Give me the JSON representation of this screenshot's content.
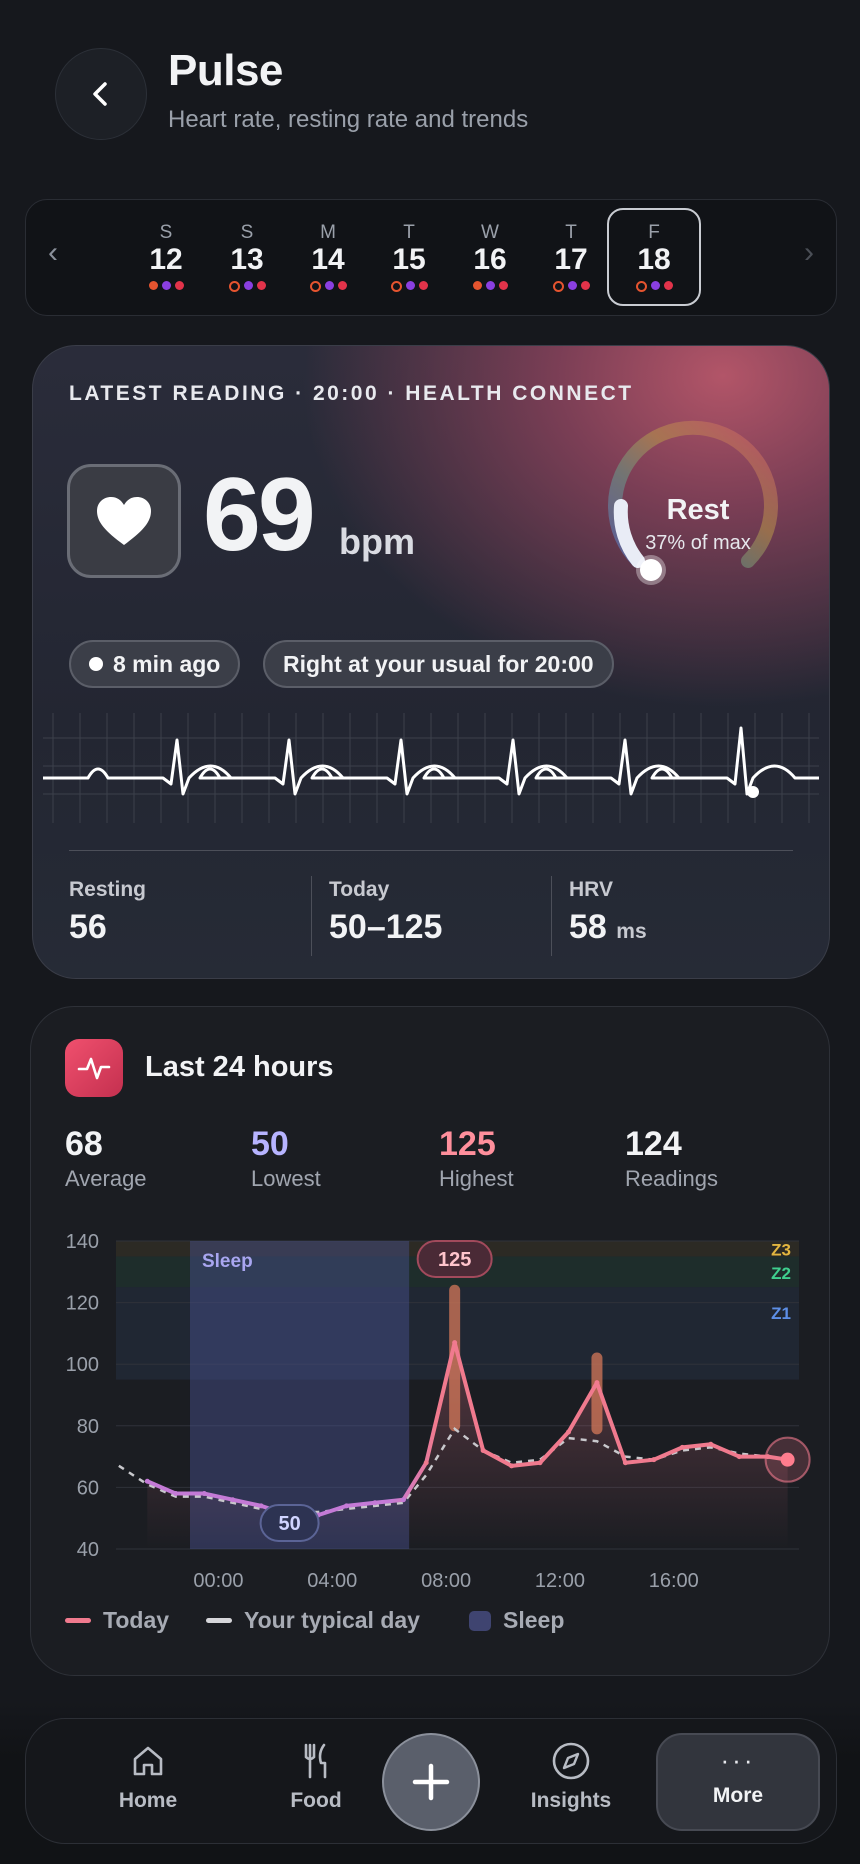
{
  "header": {
    "title": "Pulse",
    "subtitle": "Heart rate, resting rate and trends"
  },
  "days": [
    {
      "letter": "S",
      "num": "12",
      "dots": [
        "#e5542f",
        "#8a3fe0",
        "#e2334a"
      ],
      "filled": [
        true,
        true,
        true
      ]
    },
    {
      "letter": "S",
      "num": "13",
      "dots": [
        "#e5542f",
        "#8a3fe0",
        "#e2334a"
      ],
      "filled": [
        false,
        true,
        true
      ]
    },
    {
      "letter": "M",
      "num": "14",
      "dots": [
        "#e5542f",
        "#8a3fe0",
        "#e2334a"
      ],
      "filled": [
        false,
        true,
        true
      ]
    },
    {
      "letter": "T",
      "num": "15",
      "dots": [
        "#e5542f",
        "#8a3fe0",
        "#e2334a"
      ],
      "filled": [
        false,
        true,
        true
      ]
    },
    {
      "letter": "W",
      "num": "16",
      "dots": [
        "#e5542f",
        "#8a3fe0",
        "#e2334a"
      ],
      "filled": [
        true,
        true,
        true
      ]
    },
    {
      "letter": "T",
      "num": "17",
      "dots": [
        "#e5542f",
        "#8a3fe0",
        "#e2334a"
      ],
      "filled": [
        false,
        true,
        true
      ]
    },
    {
      "letter": "F",
      "num": "18",
      "dots": [
        "#e5542f",
        "#8a3fe0",
        "#e2334a"
      ],
      "filled": [
        false,
        true,
        true
      ],
      "selected": true
    }
  ],
  "latest": {
    "eyebrow": "LATEST READING · 20:00 · HEALTH CONNECT",
    "bpm": "69",
    "unit": "bpm",
    "zone": "Rest",
    "zone_pct": "37% of max",
    "pill_time": "8 min ago",
    "pill_context": "Right at your usual for 20:00",
    "stats": [
      {
        "label": "Resting",
        "value": "56",
        "unit": ""
      },
      {
        "label": "Today",
        "value": "50–125",
        "unit": ""
      },
      {
        "label": "HRV",
        "value": "58",
        "unit": "ms"
      }
    ]
  },
  "last24": {
    "title": "Last 24 hours",
    "kpis": [
      {
        "value": "68",
        "label": "Average",
        "color": "#f2f3f5"
      },
      {
        "value": "50",
        "label": "Lowest",
        "color": "#b7b4ff"
      },
      {
        "value": "125",
        "label": "Highest",
        "color": "#ff8f9c"
      },
      {
        "value": "124",
        "label": "Readings",
        "color": "#f2f3f5"
      }
    ],
    "legend": {
      "today": "Today",
      "typical": "Your typical day",
      "sleep": "Sleep"
    }
  },
  "chart_data": {
    "type": "line",
    "y_ticks": [
      140,
      120,
      100,
      80,
      60,
      40
    ],
    "x_ticks": [
      "00:00",
      "04:00",
      "08:00",
      "12:00",
      "16:00"
    ],
    "ylim": [
      40,
      140
    ],
    "x_range_hours": [
      -2.5,
      20
    ],
    "series": [
      {
        "name": "Today",
        "color": "#f07a8e",
        "x": [
          -2.5,
          -1.5,
          -0.5,
          0.5,
          1.5,
          2.5,
          3.5,
          4.5,
          5.5,
          6.5,
          7.3,
          8.3,
          9.3,
          10.3,
          11.3,
          12.3,
          13.3,
          14.3,
          15.3,
          16.3,
          17.3,
          18.3,
          19.3,
          20
        ],
        "y": [
          62,
          58,
          58,
          56,
          54,
          51,
          51,
          54,
          55,
          56,
          68,
          107,
          72,
          67,
          68,
          78,
          94,
          68,
          69,
          73,
          74,
          70,
          70,
          69
        ]
      },
      {
        "name": "Your typical day",
        "color": "#c8c8cc",
        "x": [
          -3.5,
          -2.5,
          -1.5,
          -0.5,
          0.5,
          1.5,
          2.5,
          3.5,
          4.5,
          5.5,
          6.5,
          7.3,
          8.3,
          9.3,
          10.3,
          11.3,
          12.3,
          13.3,
          14.3,
          15.3,
          16.3,
          17.3,
          18.3,
          19.3
        ],
        "y": [
          67,
          61,
          57,
          57,
          55,
          53,
          52,
          52,
          53,
          54,
          55,
          64,
          79,
          72,
          68,
          69,
          76,
          75,
          70,
          69,
          72,
          73,
          71,
          70
        ]
      }
    ],
    "sleep_band": {
      "label": "Sleep",
      "from_hour": -1.0,
      "to_hour": 6.7
    },
    "zones": [
      {
        "label": "Z3",
        "from": 135,
        "to": 140,
        "color": "#e3b640"
      },
      {
        "label": "Z2",
        "from": 125,
        "to": 135,
        "color": "#3fcf8e"
      },
      {
        "label": "Z1",
        "from": 95,
        "to": 125,
        "color": "#5d8fe6"
      }
    ],
    "markers": [
      {
        "label": "125",
        "x": 8.3,
        "y": 125,
        "kind": "max"
      },
      {
        "label": "50",
        "x": 2.5,
        "y": 50,
        "kind": "min"
      }
    ],
    "spikes": [
      {
        "x": 8.3,
        "from": 80,
        "to": 124
      },
      {
        "x": 13.3,
        "from": 79,
        "to": 102
      }
    ]
  },
  "nav": {
    "home": "Home",
    "food": "Food",
    "insights": "Insights",
    "more": "More"
  }
}
